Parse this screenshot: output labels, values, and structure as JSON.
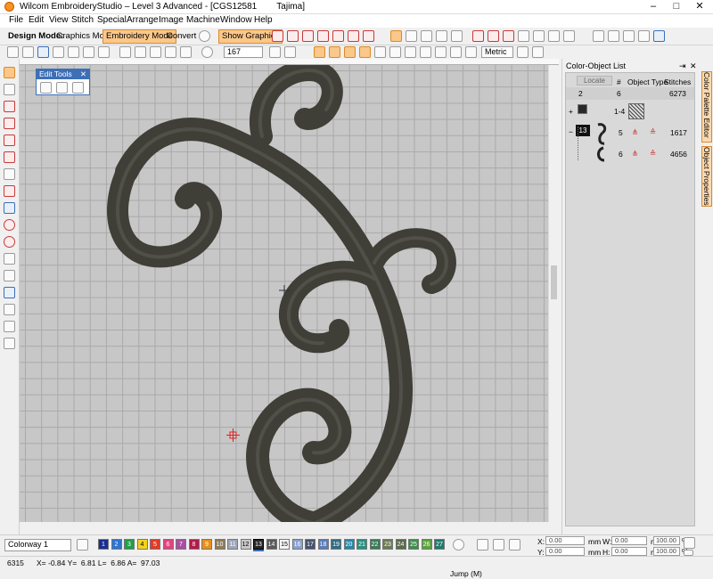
{
  "window": {
    "title": "Wilcom EmbroideryStudio – Level 3 Advanced - [CGS12581        Tajima]",
    "controls": [
      "–",
      "□",
      "✕"
    ]
  },
  "menu": [
    "File",
    "Edit",
    "View",
    "Stitch",
    "Special",
    "Arrange",
    "Image",
    "Machine",
    "Window",
    "Help"
  ],
  "mode_toolbar": {
    "label": "Design Mode:",
    "graphics_mode": "Graphics Mode",
    "embroidery_mode": "Embroidery Mode",
    "convert": "Convert",
    "show_graphics": "Show Graphics"
  },
  "std_toolbar": {
    "zoom_value": "167",
    "units": "Metric"
  },
  "edit_tools": {
    "title": "Edit Tools",
    "close": "✕"
  },
  "panel": {
    "title": "Color-Object List",
    "pin": "⇥",
    "close": "✕",
    "locate": "Locate",
    "columns": [
      "#",
      "Object Type",
      "Stitches"
    ],
    "rows": [
      {
        "color": "2",
        "num": "6",
        "type": "",
        "stitches": "6273"
      },
      {
        "color": "",
        "num": "1-4",
        "type": "",
        "stitches": ""
      },
      {
        "color": "13",
        "num": "5",
        "type": "",
        "stitches": "1617"
      },
      {
        "color": "",
        "num": "6",
        "type": "",
        "stitches": "4656"
      }
    ]
  },
  "side_tabs": [
    "Color Palette Editor",
    "Object Properties"
  ],
  "colorway": {
    "name": "Colorway 1",
    "swatches": [
      {
        "n": "1",
        "c": "#1b2e8f"
      },
      {
        "n": "2",
        "c": "#2f74d0"
      },
      {
        "n": "3",
        "c": "#1fa047"
      },
      {
        "n": "4",
        "c": "#f3d21c"
      },
      {
        "n": "5",
        "c": "#e23a2a"
      },
      {
        "n": "6",
        "c": "#e0457d"
      },
      {
        "n": "7",
        "c": "#a74fa2"
      },
      {
        "n": "8",
        "c": "#b21a4a"
      },
      {
        "n": "9",
        "c": "#e6901e"
      },
      {
        "n": "10",
        "c": "#8e7c5a"
      },
      {
        "n": "11",
        "c": "#9ea7b7"
      },
      {
        "n": "12",
        "c": "#c8c8c8"
      },
      {
        "n": "13",
        "c": "#262626"
      },
      {
        "n": "14",
        "c": "#5a5a5a"
      },
      {
        "n": "15",
        "c": "#f7f7f7"
      },
      {
        "n": "16",
        "c": "#8aa0cf"
      },
      {
        "n": "17",
        "c": "#47526e"
      },
      {
        "n": "18",
        "c": "#5d7cb5"
      },
      {
        "n": "19",
        "c": "#2f6c84"
      },
      {
        "n": "20",
        "c": "#2b86a8"
      },
      {
        "n": "21",
        "c": "#2a8e80"
      },
      {
        "n": "22",
        "c": "#3b7a58"
      },
      {
        "n": "23",
        "c": "#6b7b55"
      },
      {
        "n": "24",
        "c": "#5a6b4a"
      },
      {
        "n": "25",
        "c": "#3c8e4c"
      },
      {
        "n": "26",
        "c": "#5aa33f"
      },
      {
        "n": "27",
        "c": "#1f7a6a"
      }
    ]
  },
  "coords": {
    "x_label": "X:",
    "x": "0.00",
    "x_unit": "mm",
    "y_label": "Y:",
    "y": "0.00",
    "y_unit": "mm",
    "w_label": "W:",
    "w": "0.00",
    "w_unit": "mm",
    "h_label": "H:",
    "h": "0.00",
    "h_unit": "mm",
    "w_pct": "100.00",
    "h_pct": "100.00",
    "pct": "%"
  },
  "status": {
    "stitches": "6315",
    "coords": "X= -0.84 Y=  6.81 L=  6.86 A=  97.03",
    "mode": "Jump (M)"
  },
  "design": {
    "thread_color": "#3f3e37",
    "highlight": "#585850"
  }
}
